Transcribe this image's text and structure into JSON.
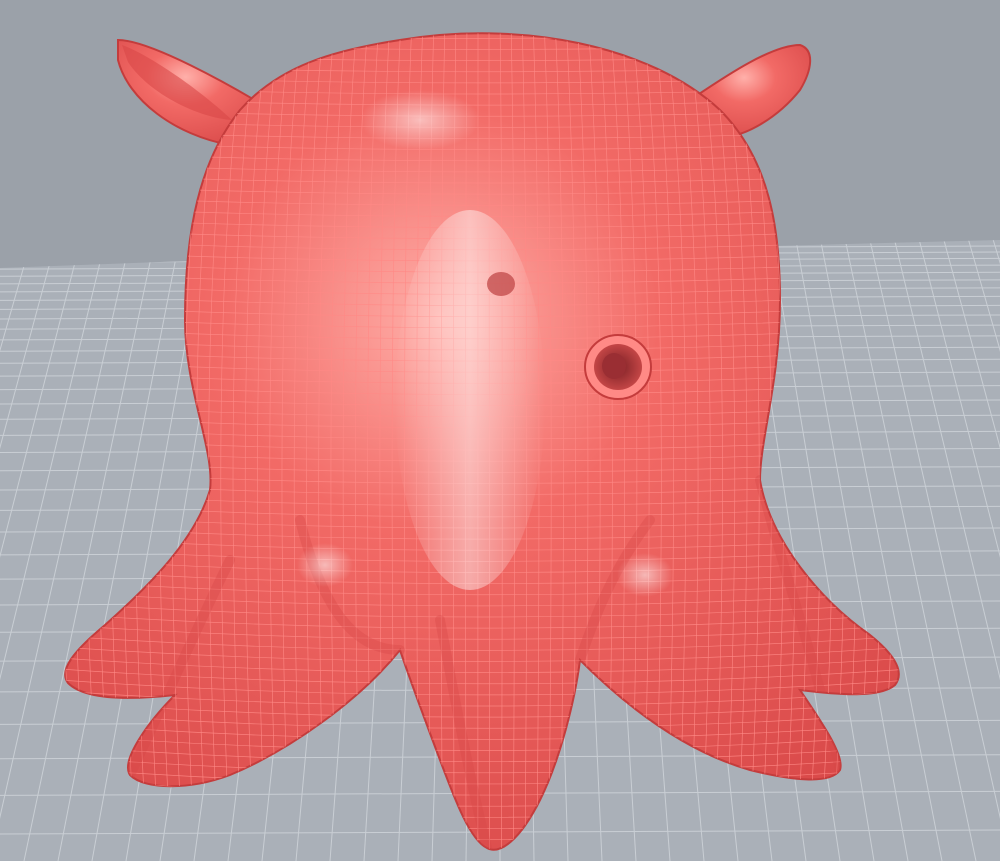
{
  "viewport": {
    "colors": {
      "background": "#9ba1a9",
      "ground": "#aab0b8",
      "grid_line": "#c9ced4",
      "model_fill": "#ef5b5b",
      "model_shade": "#d84848",
      "model_highlight": "#ffb0aa",
      "wire": "#ff8a86",
      "silhouette": "#c43c3c"
    },
    "model": {
      "name": "octopus",
      "display_mode": "shaded-wireframe"
    }
  }
}
